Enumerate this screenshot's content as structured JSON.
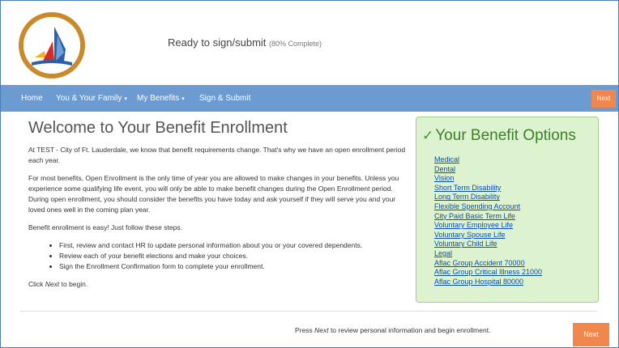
{
  "header": {
    "progress_text": "Ready to sign/submit",
    "progress_detail": "(80% Complete)",
    "progress_percent": 80
  },
  "nav": {
    "items": [
      {
        "label": "Home"
      },
      {
        "label": "You & Your Family",
        "caret": "▾"
      },
      {
        "label": "My Benefits",
        "caret": "▾"
      },
      {
        "label": "Sign & Submit"
      }
    ],
    "next_label": "Next"
  },
  "main": {
    "title": "Welcome to Your Benefit Enrollment",
    "intro": "At TEST - City of Ft. Lauderdale, we know that benefit requirements change. That's why we have an open enrollment period each year.",
    "paragraph2": "For most benefits, Open Enrollment is the only time of year you are allowed to make changes in your benefits. Unless you experience some qualifying life event, you will only be able to make benefit changes during the Open Enrollment period. During open enrollment, you should consider the benefits you have today and ask yourself if they will serve you and your loved ones well in the coming plan year.",
    "steps_intro": "Benefit enrollment is easy! Just follow these steps.",
    "steps": [
      "First, review and contact HR to update personal information about you or your covered dependents.",
      "Review each of your benefit elections and make your choices.",
      "Sign the Enrollment Confirmation form to complete your enrollment."
    ],
    "click_prefix": "Click ",
    "click_emph": "Next",
    "click_suffix": " to begin."
  },
  "options": {
    "check_icon": "✓",
    "title": "Your Benefit Options",
    "items": [
      "Medical",
      "Dental",
      "Vision",
      "Short Term Disability",
      "Long Term Disability",
      "Flexible Spending Account",
      "City Paid Basic Term Life",
      "Voluntary Employee Life",
      "Voluntary Spouse Life",
      "Voluntary Child Life",
      "Legal",
      "Aflac Group Accident 70000",
      "Aflac Group Critical Illness 21000",
      "Aflac Group Hospital 80000"
    ]
  },
  "footer": {
    "press": "Press ",
    "press_emph": "Next",
    "press_suffix": " to review personal information and begin enrollment.",
    "next_label": "Next"
  },
  "colors": {
    "nav_bg": "#6c9bd1",
    "accent_orange": "#f0874d",
    "options_bg": "#ddf2cf",
    "options_title": "#3e7f2a",
    "link": "#0b4db3"
  },
  "icons": {
    "logo": "city-seal-sailboat-logo"
  }
}
